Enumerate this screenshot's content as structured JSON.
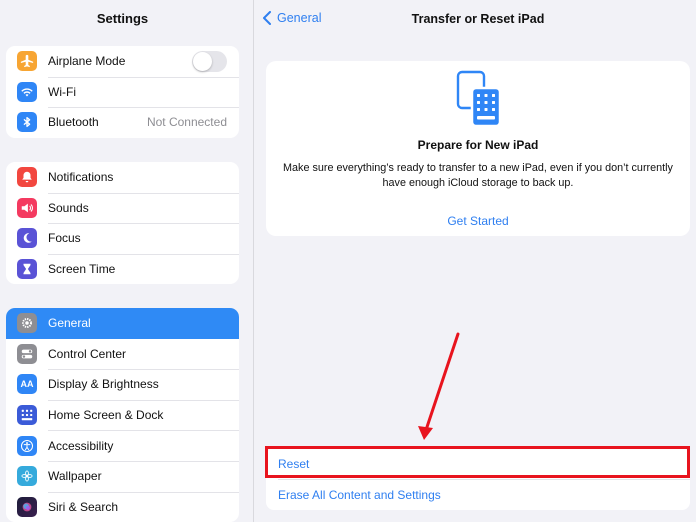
{
  "sidebar": {
    "title": "Settings",
    "groups": [
      [
        {
          "label": "Airplane Mode",
          "icon": "airplane-icon",
          "color": "#f7a533",
          "toggle": false
        },
        {
          "label": "Wi-Fi",
          "icon": "wifi-icon",
          "color": "#2f86f6"
        },
        {
          "label": "Bluetooth",
          "icon": "bluetooth-icon",
          "color": "#2f86f6",
          "detail": "Not Connected"
        }
      ],
      [
        {
          "label": "Notifications",
          "icon": "bell-icon",
          "color": "#f2473f"
        },
        {
          "label": "Sounds",
          "icon": "speaker-icon",
          "color": "#f43a60"
        },
        {
          "label": "Focus",
          "icon": "moon-icon",
          "color": "#5a53d6"
        },
        {
          "label": "Screen Time",
          "icon": "hourglass-icon",
          "color": "#5a53d6"
        }
      ],
      [
        {
          "label": "General",
          "icon": "gear-icon",
          "color": "#8e8e93",
          "selected": true
        },
        {
          "label": "Control Center",
          "icon": "toggles-icon",
          "color": "#8e8e93"
        },
        {
          "label": "Display & Brightness",
          "icon": "text-size-icon",
          "color": "#2f86f6",
          "glyph": "AA"
        },
        {
          "label": "Home Screen & Dock",
          "icon": "app-grid-icon",
          "color": "#3b5bd8"
        },
        {
          "label": "Accessibility",
          "icon": "accessibility-icon",
          "color": "#2f86f6"
        },
        {
          "label": "Wallpaper",
          "icon": "flower-icon",
          "color": "#35aadc"
        },
        {
          "label": "Siri & Search",
          "icon": "siri-icon",
          "color": "#222233"
        }
      ]
    ]
  },
  "nav": {
    "back_label": "General",
    "title": "Transfer or Reset iPad"
  },
  "card": {
    "icon": "ipad-transfer-icon",
    "title": "Prepare for New iPad",
    "description": "Make sure everything’s ready to transfer to a new iPad, even if you don’t currently have enough iCloud storage to back up.",
    "link": "Get Started"
  },
  "actions": {
    "reset_label": "Reset",
    "erase_label": "Erase All Content and Settings"
  },
  "colors": {
    "accent": "#2f7ff0",
    "selected_row": "#2f8af5",
    "annotation": "#e8141e"
  }
}
